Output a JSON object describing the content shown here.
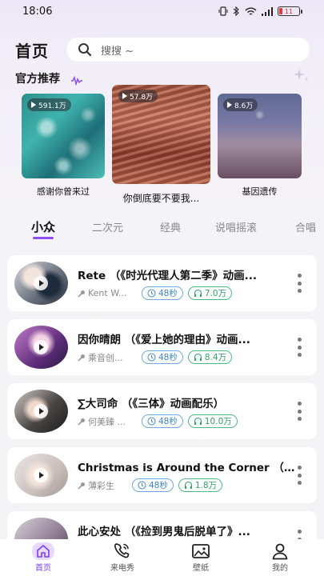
{
  "status_bar": {
    "time": "18:06",
    "battery": "11"
  },
  "header": {
    "title": "首页",
    "search_placeholder": "搜搜 ~"
  },
  "recommend": {
    "title": "官方推荐",
    "items": [
      {
        "plays": "591.1万",
        "title": "感谢你曾来过"
      },
      {
        "plays": "57.8万",
        "title": "你倒底要不要我..."
      },
      {
        "plays": "8.6万",
        "title": "基因遗传"
      }
    ]
  },
  "tabs": [
    "小众",
    "二次元",
    "经典",
    "说唱摇滚",
    "合唱"
  ],
  "songs": [
    {
      "title": "Rete （《时光代理人第二季》动画...",
      "artist": "Kent W...",
      "duration": "48秒",
      "plays": "7.0万"
    },
    {
      "title": "因你晴朗 （《爱上她的理由》动画...",
      "artist": "乘音创...",
      "duration": "48秒",
      "plays": "8.4万"
    },
    {
      "title": "∑大司命 （《三体》动画配乐）",
      "artist": "何美臻 ...",
      "duration": "48秒",
      "plays": "10.0万"
    },
    {
      "title": "Christmas is Around the Corner （...",
      "artist": "薄彩生",
      "duration": "48秒",
      "plays": "1.8万"
    },
    {
      "title": "此心安处 （《捡到男鬼后脱单了》...",
      "artist": "",
      "duration": "",
      "plays": ""
    }
  ],
  "bottom_nav": [
    {
      "label": "首页",
      "icon": "home-icon",
      "active": true
    },
    {
      "label": "来电秀",
      "icon": "phone-icon",
      "active": false
    },
    {
      "label": "壁纸",
      "icon": "wallpaper-icon",
      "active": false
    },
    {
      "label": "我的",
      "icon": "profile-icon",
      "active": false
    }
  ],
  "colors": {
    "accent": "#8e4df0",
    "duration_pill": "#3d85cf",
    "plays_pill": "#2f9f66"
  }
}
